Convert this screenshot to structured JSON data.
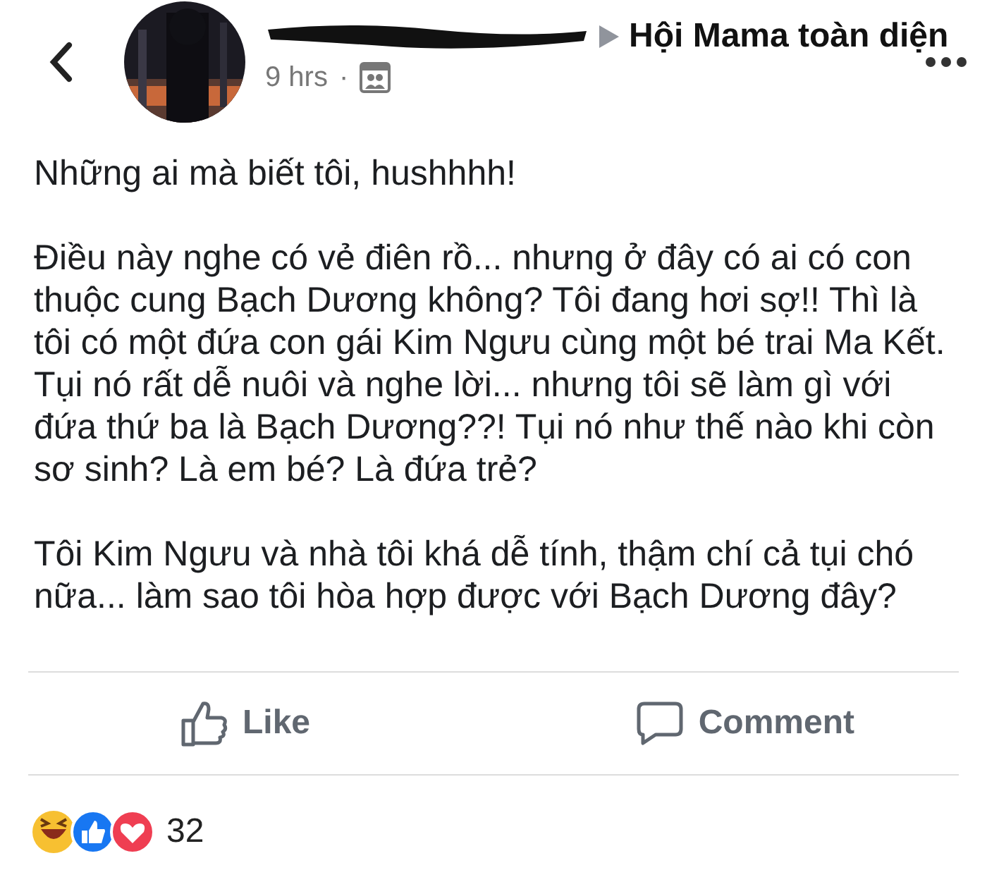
{
  "header": {
    "time": "9 hrs",
    "separator": "·",
    "group": "Hội Mama toàn diện"
  },
  "post": {
    "paragraphs": [
      [
        "Những ai mà biết tôi, hushhhh!"
      ],
      [
        "Điều này nghe có vẻ điên rồ... nhưng ở đây có ai có con",
        "thuộc cung Bạch Dương không? Tôi đang hơi sợ!! Thì là",
        "tôi có một đứa con gái Kim Ngưu cùng một bé trai Ma Kết.",
        "Tụi nó rất dễ nuôi và nghe lời... nhưng tôi sẽ làm gì với",
        "đứa thứ ba là Bạch Dương??! Tụi nó như thế nào khi còn",
        "sơ sinh? Là em bé? Là đứa trẻ?"
      ],
      [
        "Tôi Kim Ngưu và nhà tôi khá dễ tính, thậm chí cả tụi chó",
        "nữa... làm sao tôi hòa hợp được với Bạch Dương đây?"
      ]
    ]
  },
  "actions": [
    {
      "label": "Like",
      "kind": "like"
    },
    {
      "label": "Comment",
      "kind": "comment"
    }
  ],
  "reactions": {
    "count": "32"
  }
}
